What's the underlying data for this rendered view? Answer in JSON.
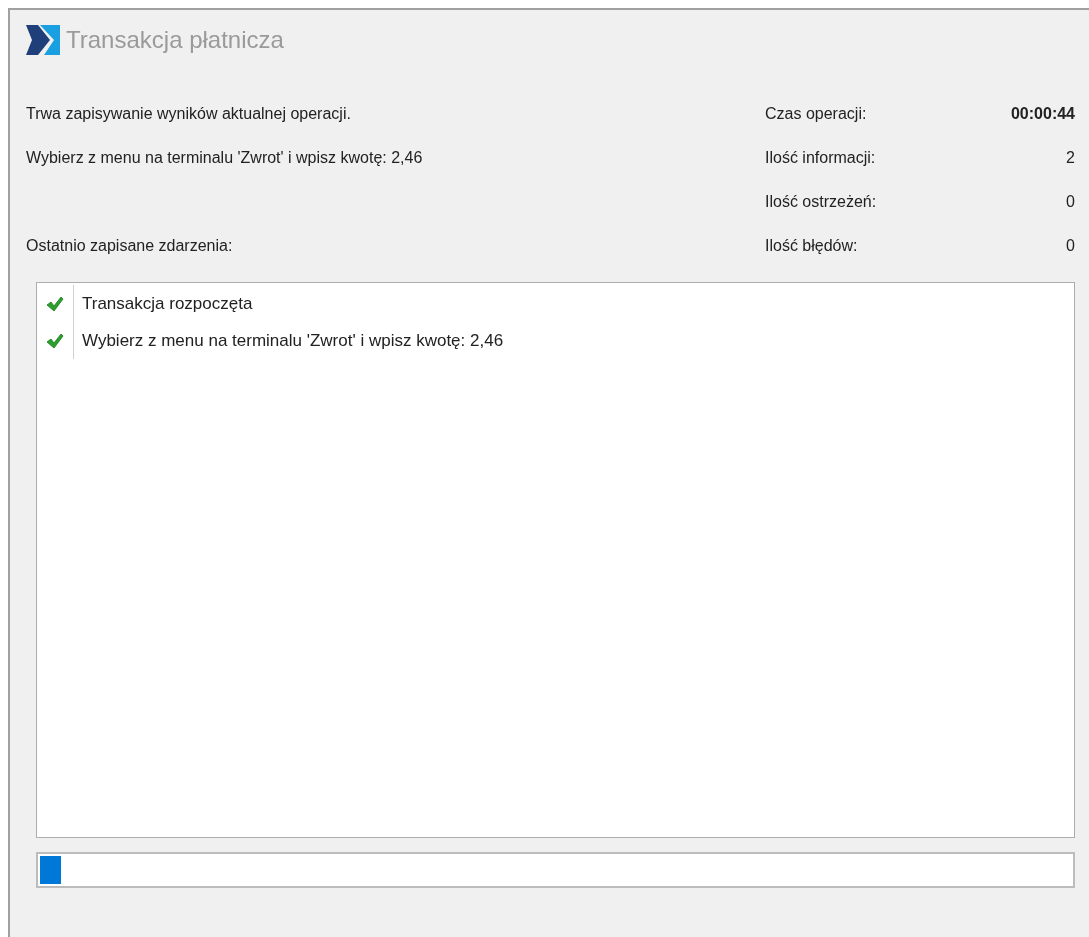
{
  "window": {
    "title": "Transakcja płatnicza"
  },
  "status_messages": [
    "Trwa zapisywanie wyników aktualnej operacji.",
    "Wybierz z menu na terminalu 'Zwrot' i wpisz kwotę: 2,46"
  ],
  "events_label": "Ostatnio zapisane zdarzenia:",
  "stats": [
    {
      "label": "Czas operacji:",
      "value": "00:00:44",
      "bold": true
    },
    {
      "label": "Ilość informacji:",
      "value": "2",
      "bold": false
    },
    {
      "label": "Ilość ostrzeżeń:",
      "value": "0",
      "bold": false
    },
    {
      "label": "Ilość błędów:",
      "value": "0",
      "bold": false
    }
  ],
  "events": [
    {
      "kind": "success",
      "text": "Transakcja rozpoczęta"
    },
    {
      "kind": "success",
      "text": "Wybierz z menu na terminalu 'Zwrot' i wpisz kwotę: 2,46"
    }
  ],
  "progress": {
    "level": 0.02
  }
}
